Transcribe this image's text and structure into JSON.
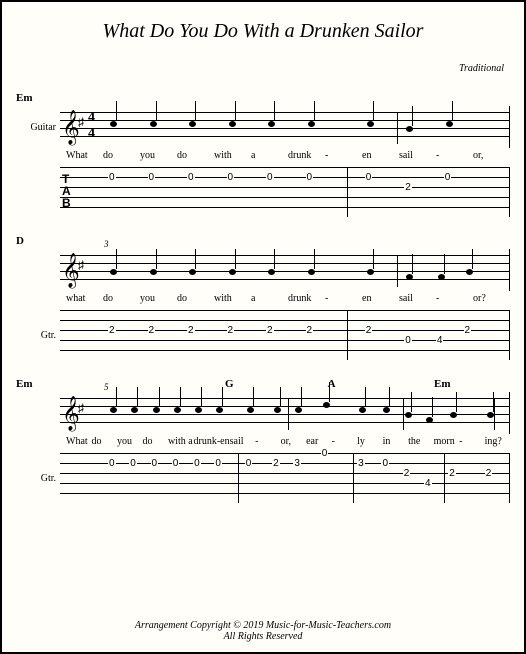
{
  "title": "What Do You Do With a Drunken Sailor",
  "composer": "Traditional",
  "instrument_full": "Guitar",
  "instrument_short": "Gtr.",
  "time_sig_top": "4",
  "time_sig_bot": "4",
  "tab_label_t": "T",
  "tab_label_a": "A",
  "tab_label_b": "B",
  "footer1": "Arrangement Copyright © 2019  Music-for-Music-Teachers.com",
  "footer2": "All Rights Reserved",
  "systems": [
    {
      "measure_num": "",
      "show_clef_extras": true,
      "chords": [
        {
          "pos": 0,
          "label": "Em"
        }
      ],
      "lyrics": [
        "What",
        "do",
        "you",
        "do",
        "with",
        "a",
        "drunk",
        "-",
        "en",
        "sail",
        "-",
        "or,"
      ],
      "tab": [
        {
          "string": 1,
          "pos": 0,
          "fret": "0"
        },
        {
          "string": 1,
          "pos": 1,
          "fret": "0"
        },
        {
          "string": 1,
          "pos": 2,
          "fret": "0"
        },
        {
          "string": 1,
          "pos": 3,
          "fret": "0"
        },
        {
          "string": 1,
          "pos": 4,
          "fret": "0"
        },
        {
          "string": 1,
          "pos": 5,
          "fret": "0"
        },
        {
          "string": 1,
          "pos": 6.5,
          "fret": "0"
        },
        {
          "string": 2,
          "pos": 7.5,
          "fret": "2"
        },
        {
          "string": 1,
          "pos": 8.5,
          "fret": "0"
        }
      ],
      "barlines": [
        6
      ],
      "cols": 10
    },
    {
      "measure_num": "3",
      "show_clef_extras": false,
      "chords": [
        {
          "pos": 0,
          "label": "D"
        }
      ],
      "lyrics": [
        "what",
        "do",
        "you",
        "do",
        "with",
        "a",
        "drunk",
        "-",
        "en",
        "sail",
        "-",
        "or?"
      ],
      "tab": [
        {
          "string": 2,
          "pos": 0,
          "fret": "2"
        },
        {
          "string": 2,
          "pos": 1,
          "fret": "2"
        },
        {
          "string": 2,
          "pos": 2,
          "fret": "2"
        },
        {
          "string": 2,
          "pos": 3,
          "fret": "2"
        },
        {
          "string": 2,
          "pos": 4,
          "fret": "2"
        },
        {
          "string": 2,
          "pos": 5,
          "fret": "2"
        },
        {
          "string": 2,
          "pos": 6.5,
          "fret": "2"
        },
        {
          "string": 3,
          "pos": 7.5,
          "fret": "0"
        },
        {
          "string": 3,
          "pos": 8.3,
          "fret": "4"
        },
        {
          "string": 2,
          "pos": 9,
          "fret": "2"
        }
      ],
      "barlines": [
        6
      ],
      "cols": 10
    },
    {
      "measure_num": "5",
      "show_clef_extras": false,
      "chords": [
        {
          "pos": 0,
          "label": "Em"
        },
        {
          "pos": 5.5,
          "label": "G"
        },
        {
          "pos": 8.2,
          "label": "A"
        },
        {
          "pos": 11,
          "label": "Em"
        }
      ],
      "lyrics": [
        "What",
        "do",
        "you",
        "do",
        "with a",
        "drunk-en",
        "sail",
        "-",
        "or,",
        "ear",
        "-",
        "ly",
        "in",
        "the",
        "morn",
        "-",
        "ing?"
      ],
      "tab": [
        {
          "string": 1,
          "pos": 0,
          "fret": "0"
        },
        {
          "string": 1,
          "pos": 0.7,
          "fret": "0"
        },
        {
          "string": 1,
          "pos": 1.4,
          "fret": "0"
        },
        {
          "string": 1,
          "pos": 2.1,
          "fret": "0"
        },
        {
          "string": 1,
          "pos": 2.8,
          "fret": "0"
        },
        {
          "string": 1,
          "pos": 3.5,
          "fret": "0"
        },
        {
          "string": 1,
          "pos": 4.5,
          "fret": "0"
        },
        {
          "string": 1,
          "pos": 5.4,
          "fret": "2"
        },
        {
          "string": 1,
          "pos": 6.1,
          "fret": "3"
        },
        {
          "string": 0,
          "pos": 7,
          "fret": "0"
        },
        {
          "string": 1,
          "pos": 8.2,
          "fret": "3"
        },
        {
          "string": 1,
          "pos": 9,
          "fret": "0"
        },
        {
          "string": 2,
          "pos": 9.7,
          "fret": "2"
        },
        {
          "string": 3,
          "pos": 10.4,
          "fret": "4"
        },
        {
          "string": 2,
          "pos": 11.2,
          "fret": "2"
        },
        {
          "string": 2,
          "pos": 12.4,
          "fret": "2"
        }
      ],
      "barlines": [
        4.2,
        8,
        11
      ],
      "cols": 13
    }
  ]
}
